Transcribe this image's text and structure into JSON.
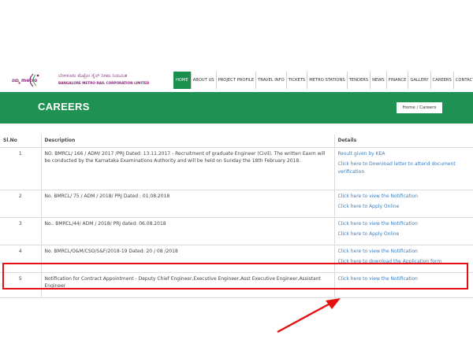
{
  "brand": {
    "logo_script": "ನಮ್ಮ metro",
    "name_kannada": "ಬೆಂಗಳೂರು ಮೆಟ್ರೋ ರೈಲ್ ನಿಗಮ ನಿಯಮಿತ",
    "name_english": "BANGALORE METRO RAIL CORPORATION LIMITED"
  },
  "nav": [
    "HOME",
    "ABOUT US",
    "PROJECT PROFILE",
    "TRAVEL INFO",
    "TICKETS",
    "METRO STATIONS",
    "TENDERS",
    "NEWS",
    "FINANCE",
    "GALLERY",
    "CAREERS",
    "CONTACT US"
  ],
  "banner": {
    "title": "CAREERS",
    "breadcrumb": "Home  /  Careers"
  },
  "table": {
    "headers": [
      "Sl.No",
      "Description",
      "Details"
    ],
    "rows": [
      {
        "sl": "1",
        "description": "NO. BMRCL/ 166 / ADM/ 2017 /PRJ Dated: 13.11.2017 - Recruitment of graduate Engineer (Civil). The written Eaxm will be conducted by the Karnataka Examinations Authority and will be held on Sunday the 18th February 2018.",
        "links": [
          "Result given by KEA",
          "Click here to Download letter to attend document verification"
        ]
      },
      {
        "sl": "2",
        "description": "No. BMRCL/ 75 / ADM / 2018/ PRJ Dated : 01.08.2018",
        "links": [
          "Click here to view the Notification",
          "Click here to Apply Online"
        ]
      },
      {
        "sl": "3",
        "description": "No.. BMRCL/44/ ADM / 2018/ PRJ dated: 06.08.2018",
        "links": [
          "Click here to view the Notification",
          "Click here to Apply Online"
        ]
      },
      {
        "sl": "4",
        "description": "No. BMRCL/O&M/CSO/S&F/2018-19 Dated: 20 / 08 /2018",
        "links": [
          "Click here to view the Notification",
          "Click here to download the Application form"
        ]
      },
      {
        "sl": "5",
        "description": "Notification for Contract Appointment - Deputy Chief Engineer,Executive Engineer,Asst Executive Engineer,Assistant Engineer",
        "links": [
          "Click here to view the Notification"
        ]
      }
    ]
  },
  "colors": {
    "green": "#1f9152",
    "nav_active": "#1b8f4e",
    "link": "#3b7fc0",
    "highlight": "#e31212",
    "brand": "#8a2a7a"
  }
}
